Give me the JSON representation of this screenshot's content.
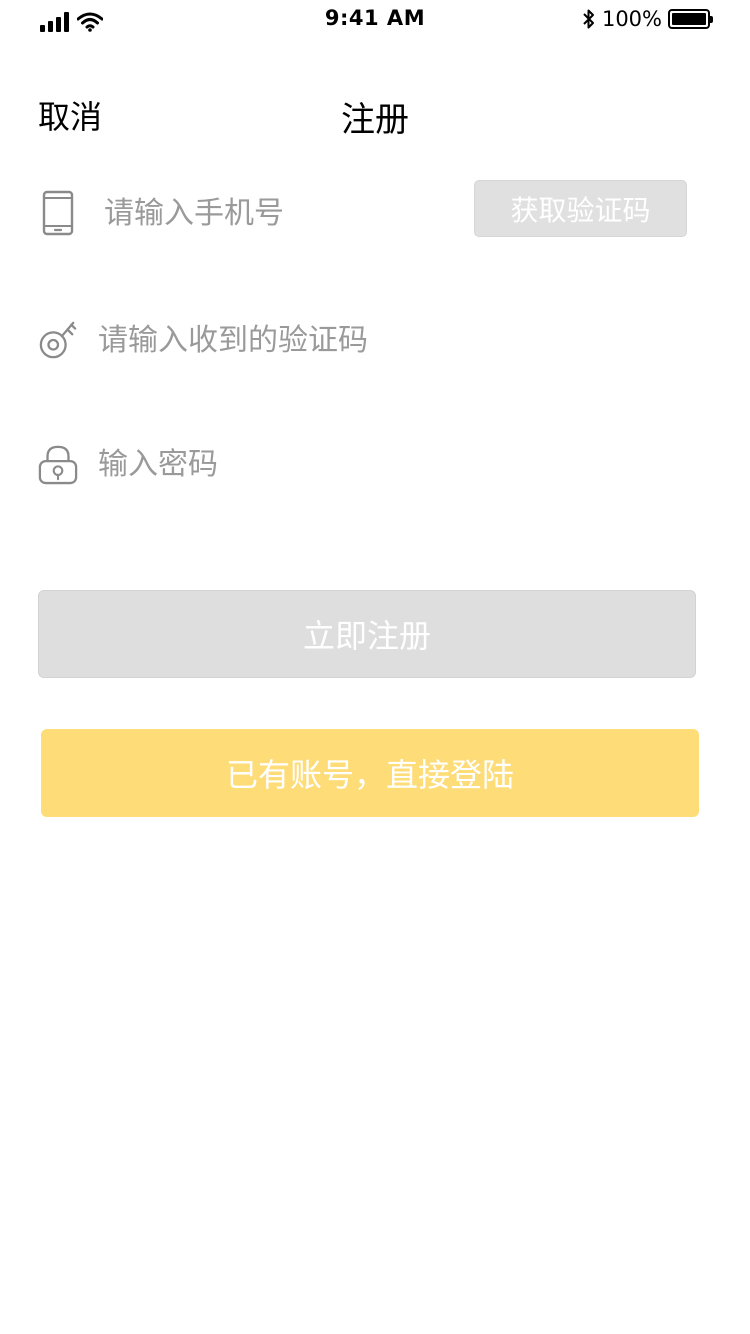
{
  "status_bar": {
    "time": "9:41 AM",
    "battery": "100%",
    "icons": [
      "signal-icon",
      "wifi-icon",
      "bluetooth-icon",
      "battery-icon"
    ]
  },
  "nav": {
    "cancel": "取消",
    "title": "注册"
  },
  "form": {
    "phone": {
      "placeholder": "请输入手机号",
      "value": "",
      "icon": "phone-icon"
    },
    "sms_button": "获取验证码",
    "code": {
      "placeholder": "请输入收到的验证码",
      "value": "",
      "icon": "key-icon"
    },
    "password": {
      "placeholder": "输入密码",
      "value": "",
      "icon": "lock-icon"
    }
  },
  "actions": {
    "register": "立即注册",
    "login": "已有账号，直接登陆"
  },
  "colors": {
    "register_bg": "#dedede",
    "login_bg": "#fedc77",
    "icon_stroke": "#8a8a8a",
    "placeholder": "#9a9a9a"
  }
}
